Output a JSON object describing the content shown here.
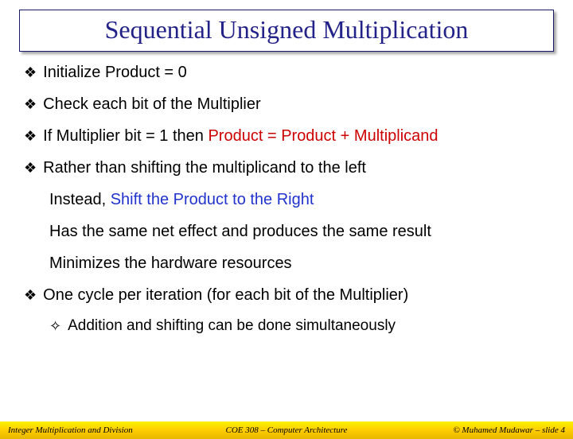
{
  "title": "Sequential Unsigned Multiplication",
  "bullets": {
    "b1": "Initialize Product = 0",
    "b2": "Check each bit of the Multiplier",
    "b3_prefix": "If Multiplier bit = 1 then ",
    "b3_red": "Product = Product + Multiplicand",
    "b4": "Rather than shifting the multiplicand to the left",
    "s1_prefix": "Instead, ",
    "s1_blue": "Shift the Product to the Right",
    "s2": "Has the same net effect and produces the same result",
    "s3": "Minimizes the hardware resources",
    "b5": "One cycle per iteration (for each bit of the Multiplier)",
    "sub2": "Addition and shifting can be done simultaneously"
  },
  "marks": {
    "l1": "❖",
    "l2": "✧"
  },
  "footer": {
    "left": "Integer Multiplication and Division",
    "center": "COE 308 – Computer Architecture",
    "right": "© Muhamed Mudawar – slide 4"
  }
}
